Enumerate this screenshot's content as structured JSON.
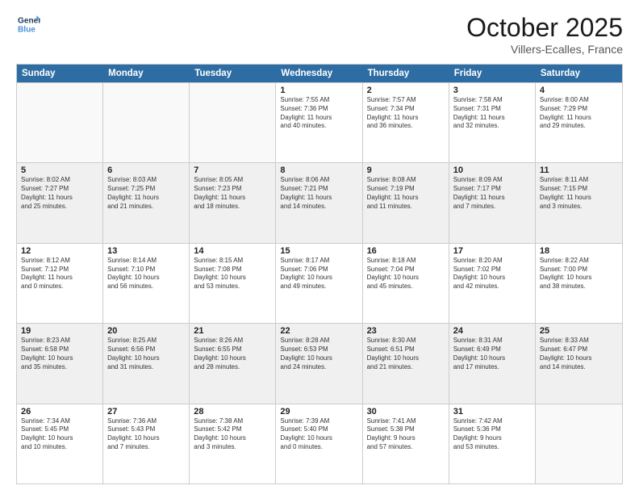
{
  "header": {
    "logo_line1": "General",
    "logo_line2": "Blue",
    "month": "October 2025",
    "location": "Villers-Ecalles, France"
  },
  "weekdays": [
    "Sunday",
    "Monday",
    "Tuesday",
    "Wednesday",
    "Thursday",
    "Friday",
    "Saturday"
  ],
  "rows": [
    [
      {
        "day": "",
        "empty": true,
        "lines": []
      },
      {
        "day": "",
        "empty": true,
        "lines": []
      },
      {
        "day": "",
        "empty": true,
        "lines": []
      },
      {
        "day": "1",
        "lines": [
          "Sunrise: 7:55 AM",
          "Sunset: 7:36 PM",
          "Daylight: 11 hours",
          "and 40 minutes."
        ]
      },
      {
        "day": "2",
        "lines": [
          "Sunrise: 7:57 AM",
          "Sunset: 7:34 PM",
          "Daylight: 11 hours",
          "and 36 minutes."
        ]
      },
      {
        "day": "3",
        "lines": [
          "Sunrise: 7:58 AM",
          "Sunset: 7:31 PM",
          "Daylight: 11 hours",
          "and 32 minutes."
        ]
      },
      {
        "day": "4",
        "lines": [
          "Sunrise: 8:00 AM",
          "Sunset: 7:29 PM",
          "Daylight: 11 hours",
          "and 29 minutes."
        ]
      }
    ],
    [
      {
        "day": "5",
        "lines": [
          "Sunrise: 8:02 AM",
          "Sunset: 7:27 PM",
          "Daylight: 11 hours",
          "and 25 minutes."
        ]
      },
      {
        "day": "6",
        "lines": [
          "Sunrise: 8:03 AM",
          "Sunset: 7:25 PM",
          "Daylight: 11 hours",
          "and 21 minutes."
        ]
      },
      {
        "day": "7",
        "lines": [
          "Sunrise: 8:05 AM",
          "Sunset: 7:23 PM",
          "Daylight: 11 hours",
          "and 18 minutes."
        ]
      },
      {
        "day": "8",
        "lines": [
          "Sunrise: 8:06 AM",
          "Sunset: 7:21 PM",
          "Daylight: 11 hours",
          "and 14 minutes."
        ]
      },
      {
        "day": "9",
        "lines": [
          "Sunrise: 8:08 AM",
          "Sunset: 7:19 PM",
          "Daylight: 11 hours",
          "and 11 minutes."
        ]
      },
      {
        "day": "10",
        "lines": [
          "Sunrise: 8:09 AM",
          "Sunset: 7:17 PM",
          "Daylight: 11 hours",
          "and 7 minutes."
        ]
      },
      {
        "day": "11",
        "lines": [
          "Sunrise: 8:11 AM",
          "Sunset: 7:15 PM",
          "Daylight: 11 hours",
          "and 3 minutes."
        ]
      }
    ],
    [
      {
        "day": "12",
        "lines": [
          "Sunrise: 8:12 AM",
          "Sunset: 7:12 PM",
          "Daylight: 11 hours",
          "and 0 minutes."
        ]
      },
      {
        "day": "13",
        "lines": [
          "Sunrise: 8:14 AM",
          "Sunset: 7:10 PM",
          "Daylight: 10 hours",
          "and 56 minutes."
        ]
      },
      {
        "day": "14",
        "lines": [
          "Sunrise: 8:15 AM",
          "Sunset: 7:08 PM",
          "Daylight: 10 hours",
          "and 53 minutes."
        ]
      },
      {
        "day": "15",
        "lines": [
          "Sunrise: 8:17 AM",
          "Sunset: 7:06 PM",
          "Daylight: 10 hours",
          "and 49 minutes."
        ]
      },
      {
        "day": "16",
        "lines": [
          "Sunrise: 8:18 AM",
          "Sunset: 7:04 PM",
          "Daylight: 10 hours",
          "and 45 minutes."
        ]
      },
      {
        "day": "17",
        "lines": [
          "Sunrise: 8:20 AM",
          "Sunset: 7:02 PM",
          "Daylight: 10 hours",
          "and 42 minutes."
        ]
      },
      {
        "day": "18",
        "lines": [
          "Sunrise: 8:22 AM",
          "Sunset: 7:00 PM",
          "Daylight: 10 hours",
          "and 38 minutes."
        ]
      }
    ],
    [
      {
        "day": "19",
        "lines": [
          "Sunrise: 8:23 AM",
          "Sunset: 6:58 PM",
          "Daylight: 10 hours",
          "and 35 minutes."
        ]
      },
      {
        "day": "20",
        "lines": [
          "Sunrise: 8:25 AM",
          "Sunset: 6:56 PM",
          "Daylight: 10 hours",
          "and 31 minutes."
        ]
      },
      {
        "day": "21",
        "lines": [
          "Sunrise: 8:26 AM",
          "Sunset: 6:55 PM",
          "Daylight: 10 hours",
          "and 28 minutes."
        ]
      },
      {
        "day": "22",
        "lines": [
          "Sunrise: 8:28 AM",
          "Sunset: 6:53 PM",
          "Daylight: 10 hours",
          "and 24 minutes."
        ]
      },
      {
        "day": "23",
        "lines": [
          "Sunrise: 8:30 AM",
          "Sunset: 6:51 PM",
          "Daylight: 10 hours",
          "and 21 minutes."
        ]
      },
      {
        "day": "24",
        "lines": [
          "Sunrise: 8:31 AM",
          "Sunset: 6:49 PM",
          "Daylight: 10 hours",
          "and 17 minutes."
        ]
      },
      {
        "day": "25",
        "lines": [
          "Sunrise: 8:33 AM",
          "Sunset: 6:47 PM",
          "Daylight: 10 hours",
          "and 14 minutes."
        ]
      }
    ],
    [
      {
        "day": "26",
        "lines": [
          "Sunrise: 7:34 AM",
          "Sunset: 5:45 PM",
          "Daylight: 10 hours",
          "and 10 minutes."
        ]
      },
      {
        "day": "27",
        "lines": [
          "Sunrise: 7:36 AM",
          "Sunset: 5:43 PM",
          "Daylight: 10 hours",
          "and 7 minutes."
        ]
      },
      {
        "day": "28",
        "lines": [
          "Sunrise: 7:38 AM",
          "Sunset: 5:42 PM",
          "Daylight: 10 hours",
          "and 3 minutes."
        ]
      },
      {
        "day": "29",
        "lines": [
          "Sunrise: 7:39 AM",
          "Sunset: 5:40 PM",
          "Daylight: 10 hours",
          "and 0 minutes."
        ]
      },
      {
        "day": "30",
        "lines": [
          "Sunrise: 7:41 AM",
          "Sunset: 5:38 PM",
          "Daylight: 9 hours",
          "and 57 minutes."
        ]
      },
      {
        "day": "31",
        "lines": [
          "Sunrise: 7:42 AM",
          "Sunset: 5:36 PM",
          "Daylight: 9 hours",
          "and 53 minutes."
        ]
      },
      {
        "day": "",
        "empty": true,
        "lines": []
      }
    ]
  ]
}
